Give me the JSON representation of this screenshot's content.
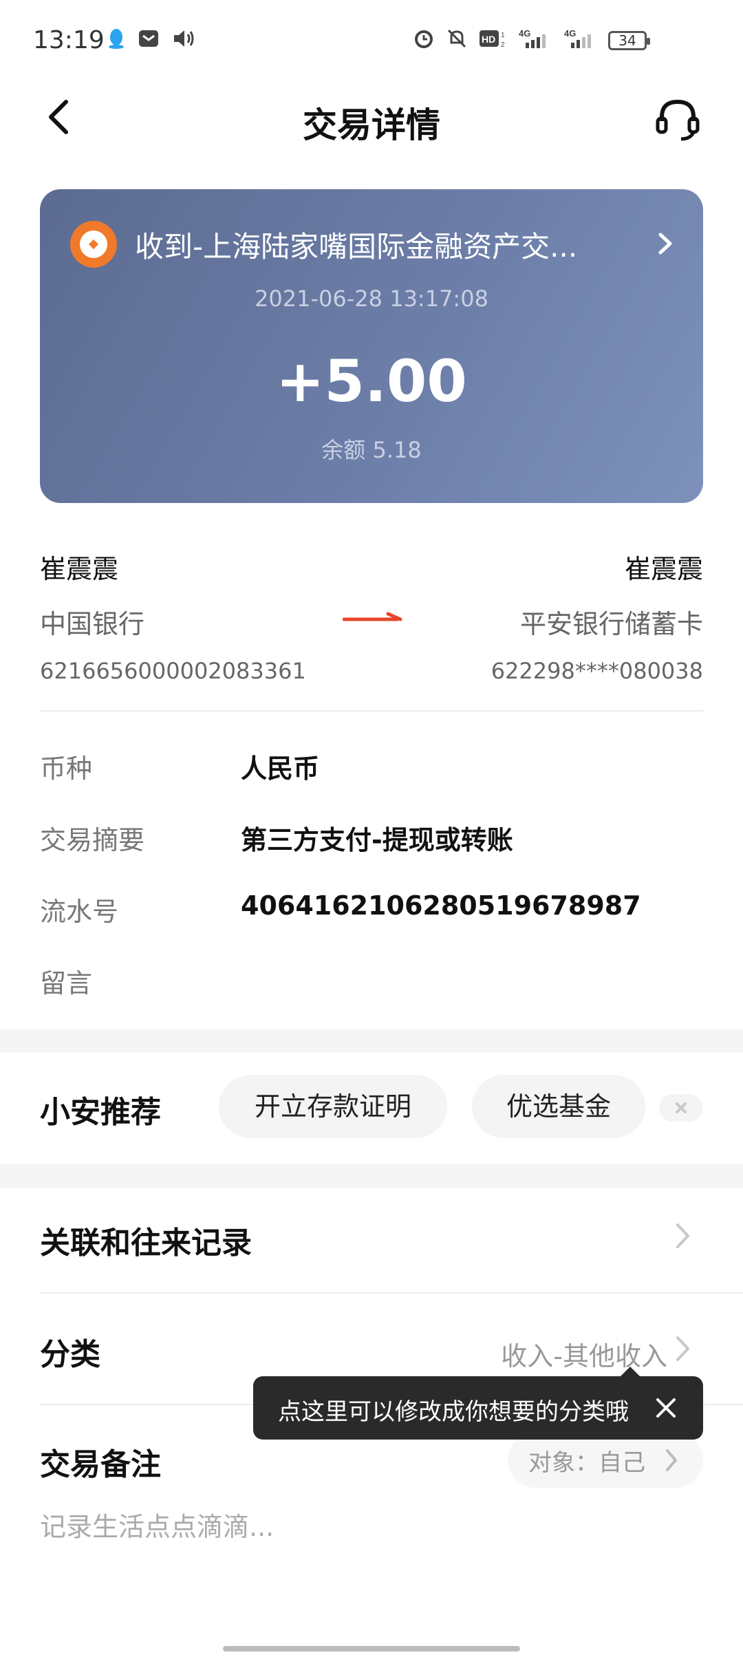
{
  "status_bar": {
    "time": "13:19",
    "left_icons": [
      "qq-icon",
      "mail-icon",
      "speaker-icon"
    ],
    "right_icons": [
      "alarm-icon",
      "mute-bell-icon",
      "hd-icon",
      "4g-signal-icon",
      "4g-signal-icon-2"
    ],
    "battery": "34"
  },
  "header": {
    "title": "交易详情"
  },
  "card": {
    "title": "收到-上海陆家嘴国际金融资产交...",
    "datetime": "2021-06-28 13:17:08",
    "amount": "+5.00",
    "balance": "余额 5.18",
    "logo_color": "#f07a2a"
  },
  "transfer": {
    "from": {
      "name": "崔震震",
      "bank": "中国银行",
      "account": "6216656000002083361"
    },
    "to": {
      "name": "崔震震",
      "bank": "平安银行储蓄卡",
      "account": "622298****080038"
    },
    "arrow_color": "#e8442a"
  },
  "details": [
    {
      "label": "币种",
      "value": "人民币"
    },
    {
      "label": "交易摘要",
      "value": "第三方支付-提现或转账"
    },
    {
      "label": "流水号",
      "value": "406416210628051967898​7"
    },
    {
      "label": "留言",
      "value": ""
    }
  ],
  "recommend": {
    "title": "小安推荐",
    "chips": [
      "开立存款证明",
      "优选基金"
    ]
  },
  "related": {
    "title": "关联和往来记录"
  },
  "category": {
    "title": "分类",
    "value": "收入-其他收入"
  },
  "tooltip": {
    "text": "点这里可以修改成你想要的分类哦"
  },
  "note": {
    "title": "交易备注",
    "target": "对象：自己",
    "placeholder": "记录生活点点滴滴..."
  }
}
